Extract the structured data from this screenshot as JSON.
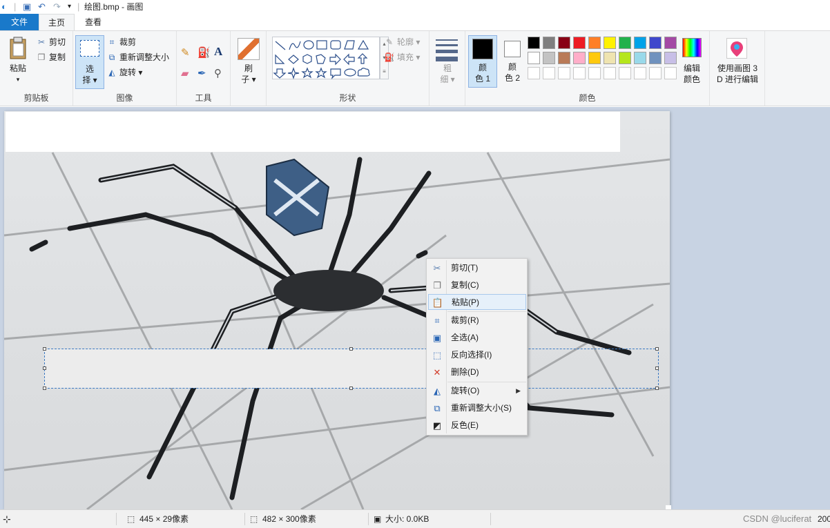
{
  "window": {
    "title": "绘图.bmp - 画图",
    "quick_access": [
      "app-icon",
      "save-icon",
      "undo-icon",
      "redo-icon",
      "customize-dropdown-icon"
    ]
  },
  "tabs": [
    {
      "label": "文件"
    },
    {
      "label": "主页"
    },
    {
      "label": "查看"
    }
  ],
  "ribbon": {
    "clipboard": {
      "paste": "粘贴",
      "cut": "剪切",
      "copy": "复制",
      "group": "剪贴板"
    },
    "image": {
      "select_top": "选",
      "select_bottom": "择",
      "crop": "裁剪",
      "resize": "重新调整大小",
      "rotate": "旋转",
      "group": "图像"
    },
    "tools": {
      "group": "工具",
      "icons": [
        "pencil-icon",
        "fill-icon",
        "text-icon",
        "eraser-icon",
        "color-picker-icon",
        "magnifier-icon"
      ]
    },
    "brush": {
      "top": "刷",
      "bottom": "子"
    },
    "shapes": {
      "outline": "轮廓",
      "fill": "填充",
      "group": "形状",
      "glyphs": [
        "╲",
        "∿",
        "○",
        "□",
        "▭",
        "⬠",
        "△",
        "◺",
        "◇",
        "⬡",
        "⬠",
        "⇨",
        "⇦",
        "⇧",
        "⇩",
        "✧",
        "☆",
        "✩",
        "🗨",
        "💬",
        "☁",
        "≡"
      ]
    },
    "size": {
      "top": "粗",
      "bottom": "细"
    },
    "colors": {
      "color1_top": "颜",
      "color1_bottom": "色 1",
      "color2_top": "颜",
      "color2_bottom": "色 2",
      "edit_top": "编辑",
      "edit_bottom": "颜色",
      "group": "颜色",
      "color1": "#000000",
      "color2": "#ffffff",
      "palette_row1": [
        "#000000",
        "#7f7f7f",
        "#880015",
        "#ed1c24",
        "#ff7f27",
        "#fff200",
        "#22b14c",
        "#00a2e8",
        "#3f48cc",
        "#a349a4"
      ],
      "palette_row2": [
        "#ffffff",
        "#c3c3c3",
        "#b97a57",
        "#ffaec9",
        "#ffc90e",
        "#efe4b0",
        "#b5e61d",
        "#99d9ea",
        "#7092be",
        "#c8bfe7"
      ]
    },
    "paint3d": {
      "line1": "使用画图 3",
      "line2": "D 进行编辑"
    }
  },
  "context_menu": {
    "items": [
      {
        "label": "剪切(T)",
        "icon": "cut-icon"
      },
      {
        "label": "复制(C)",
        "icon": "copy-icon"
      },
      {
        "label": "粘贴(P)",
        "icon": "paste-icon",
        "highlighted": true
      },
      {
        "label": "裁剪(R)",
        "icon": "crop-icon"
      },
      {
        "label": "全选(A)",
        "icon": "select-all-icon"
      },
      {
        "label": "反向选择(I)",
        "icon": "invert-selection-icon"
      },
      {
        "label": "删除(D)",
        "icon": "delete-icon"
      },
      {
        "label": "旋转(O)",
        "icon": "rotate-icon",
        "submenu": true
      },
      {
        "label": "重新调整大小(S)",
        "icon": "resize-icon"
      },
      {
        "label": "反色(E)",
        "icon": "invert-color-icon"
      }
    ]
  },
  "statusbar": {
    "selection_size": "445 × 29像素",
    "image_size": "482 × 300像素",
    "file_size": "大小: 0.0KB",
    "zoom_partial": "200",
    "watermark": "CSDN @luciferat"
  }
}
